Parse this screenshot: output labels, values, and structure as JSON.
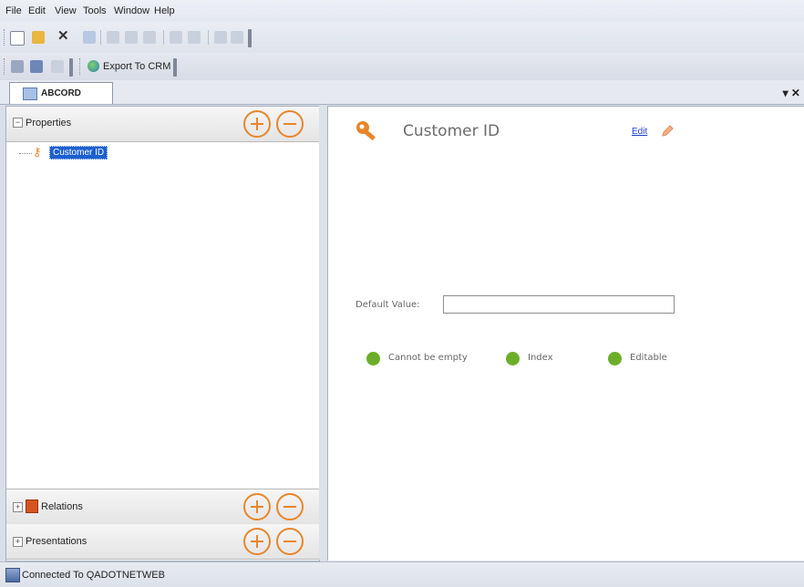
{
  "menu": {
    "items": [
      {
        "label": "File"
      },
      {
        "label": "Edit"
      },
      {
        "label": "View"
      },
      {
        "label": "Tools"
      },
      {
        "label": "Window"
      },
      {
        "label": "Help"
      }
    ]
  },
  "toolbar2": {
    "export_label": "Export To CRM"
  },
  "document_tab": {
    "label": "ABCORD",
    "close_glyph": "▾ ✕"
  },
  "left_pane": {
    "properties": {
      "label": "Properties",
      "expander": "−"
    },
    "tree": {
      "selected_item": "Customer ID"
    },
    "relations": {
      "label": "Relations",
      "expander": "+"
    },
    "presentations": {
      "label": "Presentations",
      "expander": "+"
    }
  },
  "detail": {
    "title": "Customer ID",
    "edit_label": "Edit",
    "default_value_label": "Default Value:",
    "default_value": "",
    "flags": [
      {
        "label": "Cannot be empty",
        "state": "on",
        "color": "#6cae2a"
      },
      {
        "label": "Index",
        "state": "on",
        "color": "#6cae2a"
      },
      {
        "label": "Editable",
        "state": "on",
        "color": "#6cae2a"
      }
    ]
  },
  "status": {
    "text": "Connected To QADOTNETWEB"
  },
  "colors": {
    "accent_orange": "#e8862b",
    "flag_green": "#6cae2a",
    "link_blue": "#1f3fd1"
  },
  "icons": [
    "new-icon",
    "open-icon",
    "delete-icon",
    "save-icon",
    "cut-icon",
    "copy-icon",
    "paste-icon",
    "undo-icon",
    "redo-icon",
    "key-icon",
    "pencil-icon",
    "relations-icon",
    "database-icon",
    "export-icon"
  ]
}
